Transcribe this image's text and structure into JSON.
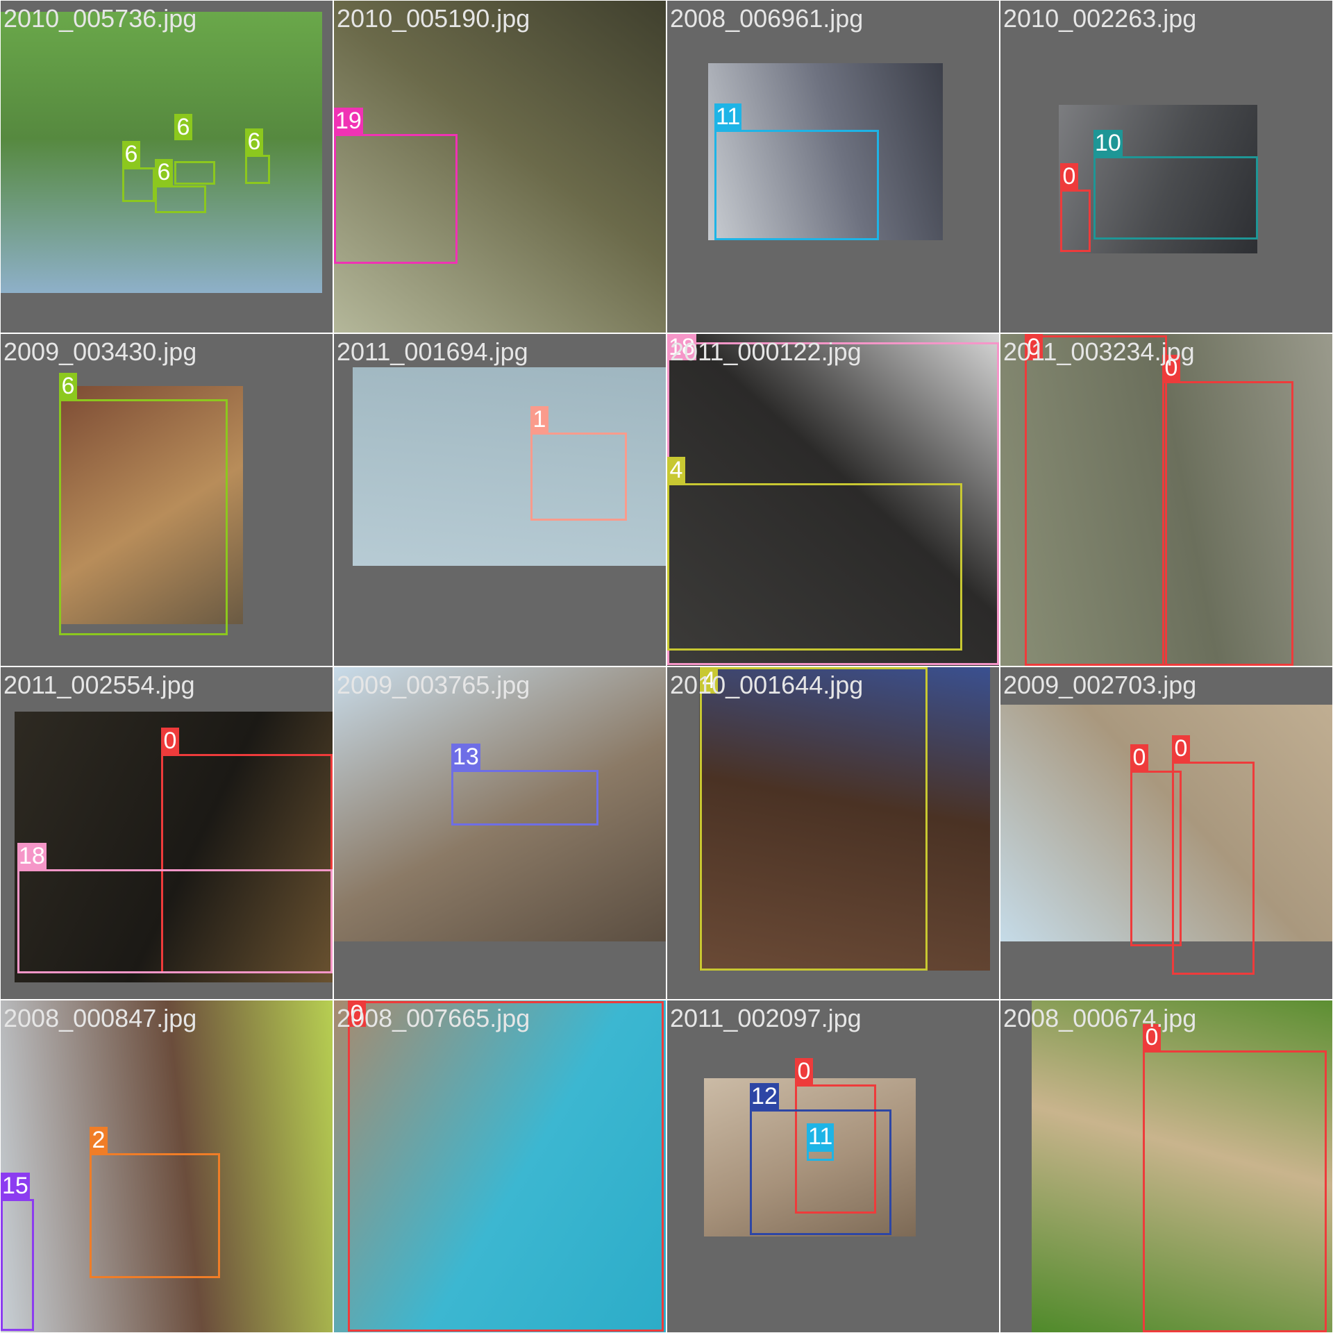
{
  "class_colors": {
    "0": "#ee3b3b",
    "1": "#fa9b8c",
    "2": "#f07d27",
    "4": "#c8c832",
    "6": "#8cc81e",
    "10": "#1e9696",
    "11": "#1eb4e6",
    "12": "#2d46a5",
    "13": "#6e6ee6",
    "15": "#8c3cf0",
    "18": "#f596c8",
    "19": "#f032b4"
  },
  "tiles": [
    {
      "label": "2010_005736.jpg",
      "photo_colors": [
        "#8eb0c9",
        "#56893f",
        "#6aa84a"
      ],
      "boxes": [
        {
          "cls": "6",
          "label": "6"
        },
        {
          "cls": "6",
          "label": "6"
        },
        {
          "cls": "6",
          "label": "6"
        },
        {
          "cls": "6",
          "label": "6"
        }
      ]
    },
    {
      "label": "2010_005190.jpg",
      "photo_colors": [
        "#b4b79a",
        "#6b6a4a",
        "#40402e"
      ],
      "boxes": [
        {
          "cls": "19",
          "label": "19"
        }
      ]
    },
    {
      "label": "2008_006961.jpg",
      "photo_colors": [
        "#c9cdd2",
        "#6e7280",
        "#3c3f49"
      ],
      "boxes": [
        {
          "cls": "11",
          "label": "11"
        }
      ]
    },
    {
      "label": "2010_002263.jpg",
      "photo_colors": [
        "#7c7d80",
        "#4a4c4f",
        "#2d2f33"
      ],
      "boxes": [
        {
          "cls": "10",
          "label": "10"
        },
        {
          "cls": "0",
          "label": "0"
        }
      ]
    },
    {
      "label": "2009_003430.jpg",
      "photo_colors": [
        "#7c4b34",
        "#b88d5a",
        "#6a5a43"
      ],
      "boxes": [
        {
          "cls": "6",
          "label": "6"
        }
      ]
    },
    {
      "label": "2011_001694.jpg",
      "photo_colors": [
        "#b7cbd4",
        "#aac0c9",
        "#9fb6c0"
      ],
      "boxes": [
        {
          "cls": "1",
          "label": "1"
        }
      ]
    },
    {
      "label": "2011_000122.jpg",
      "photo_colors": [
        "#3c3b39",
        "#2b2a29",
        "#d6d6d6"
      ],
      "boxes": [
        {
          "cls": "18",
          "label": "18"
        },
        {
          "cls": "4",
          "label": "4"
        }
      ]
    },
    {
      "label": "2011_003234.jpg",
      "photo_colors": [
        "#8a8f76",
        "#6b6f5c",
        "#9a9a8c"
      ],
      "boxes": [
        {
          "cls": "0",
          "label": "0"
        },
        {
          "cls": "0",
          "label": "0"
        }
      ]
    },
    {
      "label": "2011_002554.jpg",
      "photo_colors": [
        "#2e2a22",
        "#1b1915",
        "#6a5230"
      ],
      "boxes": [
        {
          "cls": "0",
          "label": "0"
        },
        {
          "cls": "18",
          "label": "18"
        }
      ]
    },
    {
      "label": "2009_003765.jpg",
      "photo_colors": [
        "#c8dbe9",
        "#8b7a66",
        "#5b4e41"
      ],
      "boxes": [
        {
          "cls": "13",
          "label": "13"
        }
      ]
    },
    {
      "label": "2010_001644.jpg",
      "photo_colors": [
        "#6a4a36",
        "#4a3224",
        "#3a5090"
      ],
      "boxes": [
        {
          "cls": "4",
          "label": "4"
        }
      ]
    },
    {
      "label": "2009_002703.jpg",
      "photo_colors": [
        "#c5dbe8",
        "#a9987e",
        "#c0ae92"
      ],
      "boxes": [
        {
          "cls": "0",
          "label": "0"
        },
        {
          "cls": "0",
          "label": "0"
        }
      ]
    },
    {
      "label": "2008_000847.jpg",
      "photo_colors": [
        "#c8d0d6",
        "#6b4d3c",
        "#b7cf52"
      ],
      "boxes": [
        {
          "cls": "2",
          "label": "2"
        },
        {
          "cls": "15",
          "label": "15"
        }
      ]
    },
    {
      "label": "2008_007665.jpg",
      "photo_colors": [
        "#a88a6e",
        "#3cb7d1",
        "#2cacc8"
      ],
      "boxes": [
        {
          "cls": "0",
          "label": "0"
        }
      ]
    },
    {
      "label": "2011_002097.jpg",
      "photo_colors": [
        "#cbbba6",
        "#a7927b",
        "#7d6a56"
      ],
      "boxes": [
        {
          "cls": "0",
          "label": "0"
        },
        {
          "cls": "12",
          "label": "12"
        },
        {
          "cls": "11",
          "label": "11"
        }
      ]
    },
    {
      "label": "2008_000674.jpg",
      "photo_colors": [
        "#4f8a2a",
        "#c9b48d",
        "#5c8f32"
      ],
      "boxes": [
        {
          "cls": "0",
          "label": "0"
        }
      ]
    }
  ]
}
